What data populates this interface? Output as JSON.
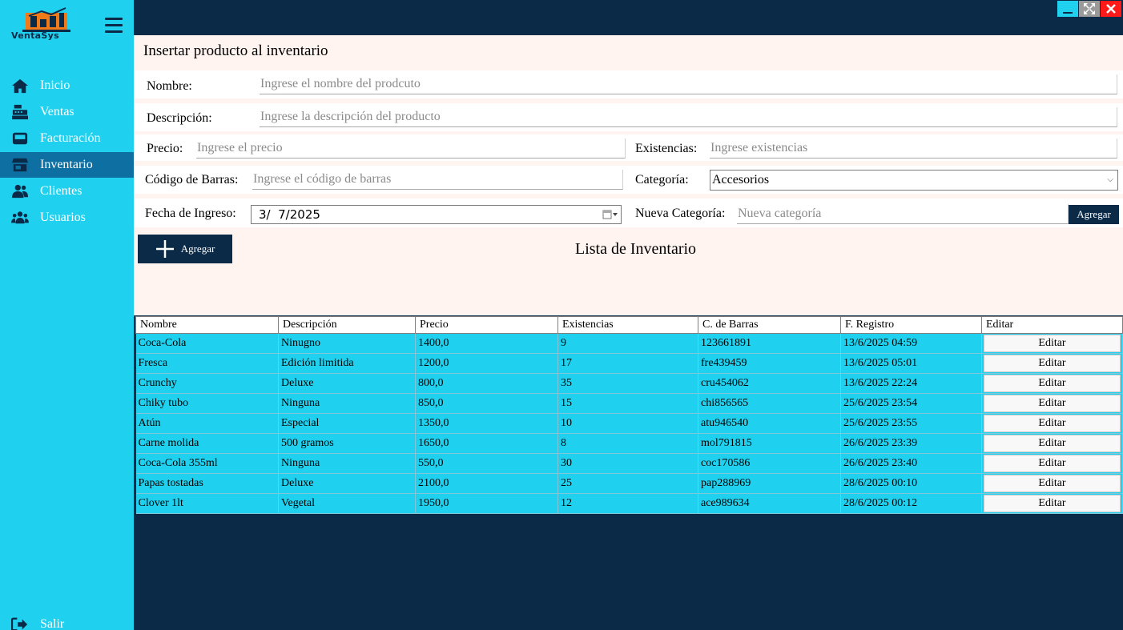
{
  "app": {
    "logo_text": "VentaSys"
  },
  "sidebar": {
    "items": [
      {
        "label": "Inicio",
        "icon": "home-icon"
      },
      {
        "label": "Ventas",
        "icon": "cash-register-icon"
      },
      {
        "label": "Facturación",
        "icon": "inbox-icon"
      },
      {
        "label": "Inventario",
        "icon": "store-icon",
        "active": true
      },
      {
        "label": "Clientes",
        "icon": "users-icon"
      },
      {
        "label": "Usuarios",
        "icon": "user-group-icon"
      }
    ],
    "logout": {
      "label": "Salir",
      "icon": "sign-out-icon"
    }
  },
  "form": {
    "title": "Insertar producto al inventario",
    "nombre": {
      "label": "Nombre:",
      "placeholder": "Ingrese el nombre del prodcuto"
    },
    "descripcion": {
      "label": "Descripción:",
      "placeholder": "Ingrese la descripción del producto"
    },
    "precio": {
      "label": "Precio:",
      "placeholder": "Ingrese el precio"
    },
    "existencias": {
      "label": "Existencias:",
      "placeholder": "Ingrese existencias"
    },
    "codigo": {
      "label": "Código de Barras:",
      "placeholder": "Ingrese el código de barras"
    },
    "categoria": {
      "label": "Categoría:",
      "value": "Accesorios"
    },
    "fecha": {
      "label": "Fecha de Ingreso:",
      "value": "3/  7/2025"
    },
    "nueva_categoria": {
      "label": "Nueva Categoría:",
      "placeholder": "Nueva categoría",
      "button": "Agregar"
    },
    "agregar_button": "Agregar"
  },
  "list_title": "Lista de Inventario",
  "table": {
    "columns": [
      "Nombre",
      "Descripción",
      "Precio",
      "Existencias",
      "C. de Barras",
      "F. Registro",
      "Editar"
    ],
    "edit_label": "Editar",
    "rows": [
      [
        "Coca-Cola",
        "Ninugno",
        "1400,0",
        "9",
        "123661891",
        "13/6/2025 04:59"
      ],
      [
        "Fresca",
        "Edición limitida",
        "1200,0",
        "17",
        "fre439459",
        "13/6/2025 05:01"
      ],
      [
        "Crunchy",
        "Deluxe",
        "800,0",
        "35",
        "cru454062",
        "13/6/2025 22:24"
      ],
      [
        "Chiky tubo",
        "Ninguna",
        "850,0",
        "15",
        "chi856565",
        "25/6/2025 23:54"
      ],
      [
        "Atún",
        "Especial",
        "1350,0",
        "10",
        "atu946540",
        "25/6/2025 23:55"
      ],
      [
        "Carne molida",
        "500 gramos",
        "1650,0",
        "8",
        "mol791815",
        "26/6/2025 23:39"
      ],
      [
        "Coca-Cola 355ml",
        "Ninguna",
        "550,0",
        "30",
        "coc170586",
        "26/6/2025 23:40"
      ],
      [
        "Papas tostadas",
        "Deluxe",
        "2100,0",
        "25",
        "pap288969",
        "28/6/2025 00:10"
      ],
      [
        "Clover 1lt",
        "Vegetal",
        "1950,0",
        "12",
        "ace989634",
        "28/6/2025 00:12"
      ]
    ]
  },
  "colors": {
    "sidebar": "#1fd1ef",
    "dark": "#0b2a48",
    "active": "#0e6fa2",
    "panel": "#fff4ef"
  }
}
